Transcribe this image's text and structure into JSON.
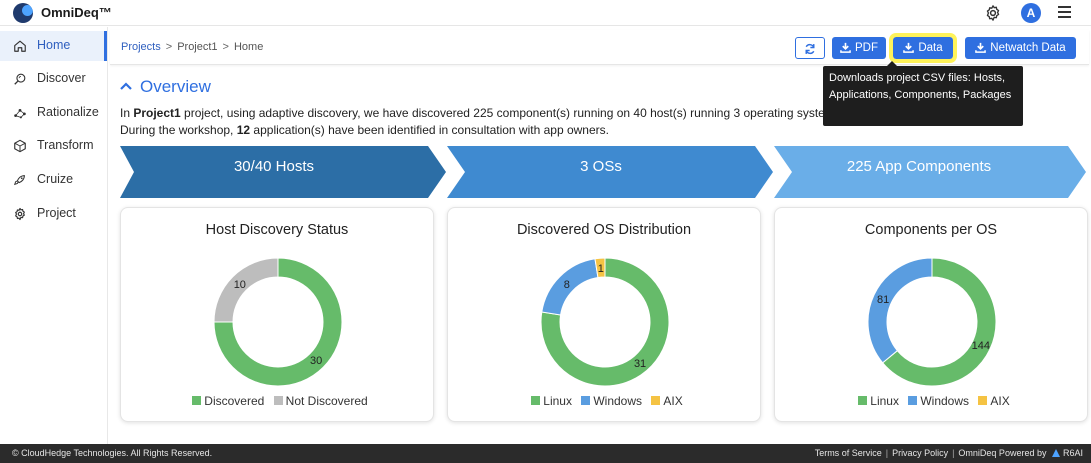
{
  "app": {
    "title": "OmniDeq™",
    "avatar_letter": "A"
  },
  "sidebar": {
    "items": [
      {
        "label": "Home",
        "icon": "home-icon",
        "active": true
      },
      {
        "label": "Discover",
        "icon": "discover-icon"
      },
      {
        "label": "Rationalize",
        "icon": "rationalize-icon"
      },
      {
        "label": "Transform",
        "icon": "transform-icon"
      },
      {
        "label": "Cruize",
        "icon": "cruize-icon"
      },
      {
        "label": "Project",
        "icon": "project-icon"
      }
    ]
  },
  "breadcrumb": [
    "Projects",
    "Project1",
    "Home"
  ],
  "toolbar": {
    "pdf_label": "PDF",
    "data_label": "Data",
    "netwatch_label": "Netwatch Data"
  },
  "tooltip": {
    "text": "Downloads project CSV files: Hosts, Applications, Components, Packages"
  },
  "overview": {
    "title": "Overview",
    "line1": {
      "pre": "In ",
      "project": "Project1",
      "mid": " project, using adaptive discovery, we have discovered 225 component(s) running on 40 host(s) running 3 operating system(s)"
    },
    "line2": {
      "pre": "During the workshop, ",
      "count": "12",
      "post": " application(s) have been identified in consultation with app owners."
    }
  },
  "chevrons": [
    "30/40 Hosts",
    "3 OSs",
    "225 App Components"
  ],
  "colors": {
    "chevron1": "#2c6ea6",
    "chevron2": "#3f8ad0",
    "chevron3": "#6aaee8",
    "green": "#66bb6a",
    "grey": "#bdbdbd",
    "blue": "#5a9de0",
    "yellow": "#f5c343",
    "accent": "#2f6fe0"
  },
  "cards": [
    {
      "title": "Host Discovery Status",
      "legend": [
        "Discovered",
        "Not Discovered"
      ]
    },
    {
      "title": "Discovered OS Distribution",
      "legend": [
        "Linux",
        "Windows",
        "AIX"
      ]
    },
    {
      "title": "Components per OS",
      "legend": [
        "Linux",
        "Windows",
        "AIX"
      ]
    }
  ],
  "chart_data": [
    {
      "type": "pie",
      "title": "Host Discovery Status",
      "categories": [
        "Discovered",
        "Not Discovered"
      ],
      "values": [
        30,
        10
      ],
      "colors": [
        "#66bb6a",
        "#bdbdbd"
      ],
      "legend": "bottom"
    },
    {
      "type": "pie",
      "title": "Discovered OS Distribution",
      "categories": [
        "Linux",
        "Windows",
        "AIX"
      ],
      "values": [
        31,
        8,
        1
      ],
      "colors": [
        "#66bb6a",
        "#5a9de0",
        "#f5c343"
      ],
      "legend": "bottom"
    },
    {
      "type": "pie",
      "title": "Components per OS",
      "categories": [
        "Linux",
        "Windows",
        "AIX"
      ],
      "values": [
        144,
        81,
        0
      ],
      "colors": [
        "#66bb6a",
        "#5a9de0",
        "#f5c343"
      ],
      "legend": "bottom"
    }
  ],
  "footer": {
    "copyright": "© CloudHedge Technologies. All Rights Reserved.",
    "terms": "Terms of Service",
    "privacy": "Privacy Policy",
    "powered": "OmniDeq Powered by",
    "brand": "R6AI"
  }
}
